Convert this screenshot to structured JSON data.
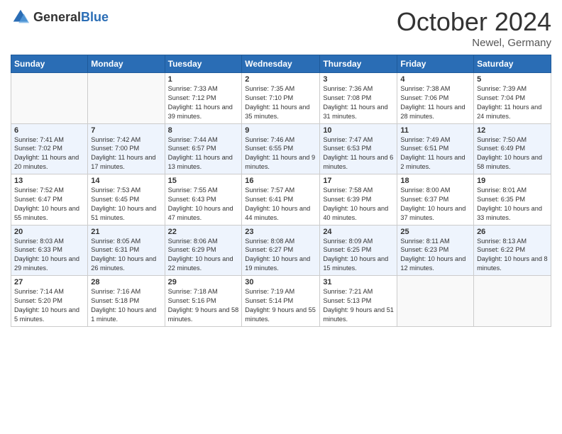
{
  "logo": {
    "general": "General",
    "blue": "Blue"
  },
  "header": {
    "month": "October 2024",
    "location": "Newel, Germany"
  },
  "weekdays": [
    "Sunday",
    "Monday",
    "Tuesday",
    "Wednesday",
    "Thursday",
    "Friday",
    "Saturday"
  ],
  "weeks": [
    [
      {
        "day": null
      },
      {
        "day": null
      },
      {
        "day": "1",
        "sunrise": "Sunrise: 7:33 AM",
        "sunset": "Sunset: 7:12 PM",
        "daylight": "Daylight: 11 hours and 39 minutes."
      },
      {
        "day": "2",
        "sunrise": "Sunrise: 7:35 AM",
        "sunset": "Sunset: 7:10 PM",
        "daylight": "Daylight: 11 hours and 35 minutes."
      },
      {
        "day": "3",
        "sunrise": "Sunrise: 7:36 AM",
        "sunset": "Sunset: 7:08 PM",
        "daylight": "Daylight: 11 hours and 31 minutes."
      },
      {
        "day": "4",
        "sunrise": "Sunrise: 7:38 AM",
        "sunset": "Sunset: 7:06 PM",
        "daylight": "Daylight: 11 hours and 28 minutes."
      },
      {
        "day": "5",
        "sunrise": "Sunrise: 7:39 AM",
        "sunset": "Sunset: 7:04 PM",
        "daylight": "Daylight: 11 hours and 24 minutes."
      }
    ],
    [
      {
        "day": "6",
        "sunrise": "Sunrise: 7:41 AM",
        "sunset": "Sunset: 7:02 PM",
        "daylight": "Daylight: 11 hours and 20 minutes."
      },
      {
        "day": "7",
        "sunrise": "Sunrise: 7:42 AM",
        "sunset": "Sunset: 7:00 PM",
        "daylight": "Daylight: 11 hours and 17 minutes."
      },
      {
        "day": "8",
        "sunrise": "Sunrise: 7:44 AM",
        "sunset": "Sunset: 6:57 PM",
        "daylight": "Daylight: 11 hours and 13 minutes."
      },
      {
        "day": "9",
        "sunrise": "Sunrise: 7:46 AM",
        "sunset": "Sunset: 6:55 PM",
        "daylight": "Daylight: 11 hours and 9 minutes."
      },
      {
        "day": "10",
        "sunrise": "Sunrise: 7:47 AM",
        "sunset": "Sunset: 6:53 PM",
        "daylight": "Daylight: 11 hours and 6 minutes."
      },
      {
        "day": "11",
        "sunrise": "Sunrise: 7:49 AM",
        "sunset": "Sunset: 6:51 PM",
        "daylight": "Daylight: 11 hours and 2 minutes."
      },
      {
        "day": "12",
        "sunrise": "Sunrise: 7:50 AM",
        "sunset": "Sunset: 6:49 PM",
        "daylight": "Daylight: 10 hours and 58 minutes."
      }
    ],
    [
      {
        "day": "13",
        "sunrise": "Sunrise: 7:52 AM",
        "sunset": "Sunset: 6:47 PM",
        "daylight": "Daylight: 10 hours and 55 minutes."
      },
      {
        "day": "14",
        "sunrise": "Sunrise: 7:53 AM",
        "sunset": "Sunset: 6:45 PM",
        "daylight": "Daylight: 10 hours and 51 minutes."
      },
      {
        "day": "15",
        "sunrise": "Sunrise: 7:55 AM",
        "sunset": "Sunset: 6:43 PM",
        "daylight": "Daylight: 10 hours and 47 minutes."
      },
      {
        "day": "16",
        "sunrise": "Sunrise: 7:57 AM",
        "sunset": "Sunset: 6:41 PM",
        "daylight": "Daylight: 10 hours and 44 minutes."
      },
      {
        "day": "17",
        "sunrise": "Sunrise: 7:58 AM",
        "sunset": "Sunset: 6:39 PM",
        "daylight": "Daylight: 10 hours and 40 minutes."
      },
      {
        "day": "18",
        "sunrise": "Sunrise: 8:00 AM",
        "sunset": "Sunset: 6:37 PM",
        "daylight": "Daylight: 10 hours and 37 minutes."
      },
      {
        "day": "19",
        "sunrise": "Sunrise: 8:01 AM",
        "sunset": "Sunset: 6:35 PM",
        "daylight": "Daylight: 10 hours and 33 minutes."
      }
    ],
    [
      {
        "day": "20",
        "sunrise": "Sunrise: 8:03 AM",
        "sunset": "Sunset: 6:33 PM",
        "daylight": "Daylight: 10 hours and 29 minutes."
      },
      {
        "day": "21",
        "sunrise": "Sunrise: 8:05 AM",
        "sunset": "Sunset: 6:31 PM",
        "daylight": "Daylight: 10 hours and 26 minutes."
      },
      {
        "day": "22",
        "sunrise": "Sunrise: 8:06 AM",
        "sunset": "Sunset: 6:29 PM",
        "daylight": "Daylight: 10 hours and 22 minutes."
      },
      {
        "day": "23",
        "sunrise": "Sunrise: 8:08 AM",
        "sunset": "Sunset: 6:27 PM",
        "daylight": "Daylight: 10 hours and 19 minutes."
      },
      {
        "day": "24",
        "sunrise": "Sunrise: 8:09 AM",
        "sunset": "Sunset: 6:25 PM",
        "daylight": "Daylight: 10 hours and 15 minutes."
      },
      {
        "day": "25",
        "sunrise": "Sunrise: 8:11 AM",
        "sunset": "Sunset: 6:23 PM",
        "daylight": "Daylight: 10 hours and 12 minutes."
      },
      {
        "day": "26",
        "sunrise": "Sunrise: 8:13 AM",
        "sunset": "Sunset: 6:22 PM",
        "daylight": "Daylight: 10 hours and 8 minutes."
      }
    ],
    [
      {
        "day": "27",
        "sunrise": "Sunrise: 7:14 AM",
        "sunset": "Sunset: 5:20 PM",
        "daylight": "Daylight: 10 hours and 5 minutes."
      },
      {
        "day": "28",
        "sunrise": "Sunrise: 7:16 AM",
        "sunset": "Sunset: 5:18 PM",
        "daylight": "Daylight: 10 hours and 1 minute."
      },
      {
        "day": "29",
        "sunrise": "Sunrise: 7:18 AM",
        "sunset": "Sunset: 5:16 PM",
        "daylight": "Daylight: 9 hours and 58 minutes."
      },
      {
        "day": "30",
        "sunrise": "Sunrise: 7:19 AM",
        "sunset": "Sunset: 5:14 PM",
        "daylight": "Daylight: 9 hours and 55 minutes."
      },
      {
        "day": "31",
        "sunrise": "Sunrise: 7:21 AM",
        "sunset": "Sunset: 5:13 PM",
        "daylight": "Daylight: 9 hours and 51 minutes."
      },
      {
        "day": null
      },
      {
        "day": null
      }
    ]
  ]
}
